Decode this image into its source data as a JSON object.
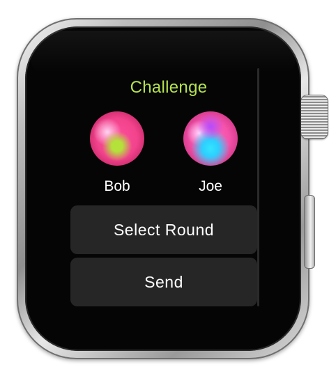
{
  "screen": {
    "title": "Challenge",
    "title_color": "#b5e34f",
    "players": [
      {
        "name": "Bob",
        "avatar": "pink-green-orb-avatar"
      },
      {
        "name": "Joe",
        "avatar": "pink-blue-orb-avatar"
      }
    ],
    "buttons": {
      "select_round": "Select Round",
      "send": "Send"
    }
  },
  "colors": {
    "background": "#000000",
    "button_bg": "#262626",
    "text": "#ffffff"
  }
}
